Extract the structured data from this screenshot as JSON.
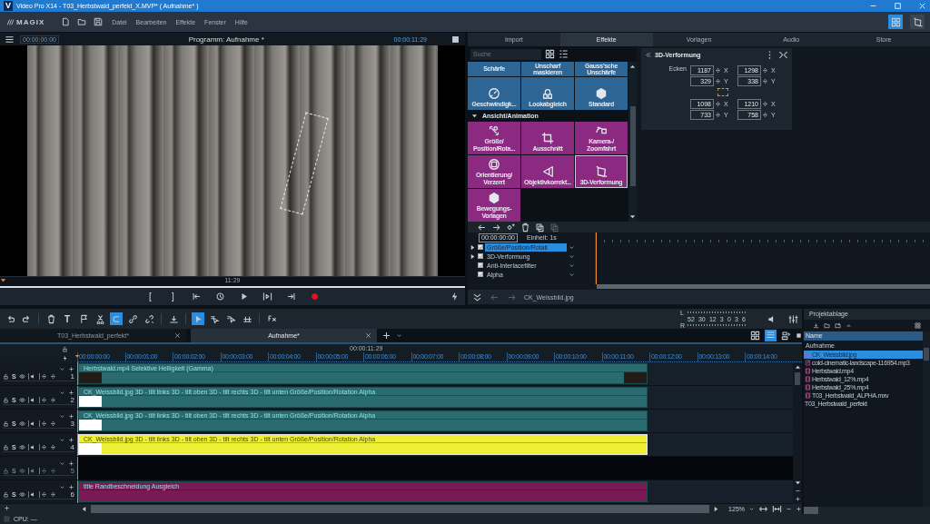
{
  "window": {
    "app_letter": "V",
    "title": "Video Pro X14 - T03_Herbstwald_perfekt_X.MVP* ( Aufnahme* )"
  },
  "menubar": {
    "logo": "MAGIX",
    "items": [
      "Datei",
      "Bearbeiten",
      "Effekte",
      "Fenster",
      "Hilfe"
    ]
  },
  "player": {
    "timecode": "00:00:00:00",
    "title": "Programm: Aufnahme *",
    "duration": "00:00:11:29",
    "scrub_label": "11:29",
    "mark_in": "[",
    "mark_out": "]"
  },
  "media_tabs": [
    {
      "label": "Import",
      "selected": false
    },
    {
      "label": "Effekte",
      "selected": true
    },
    {
      "label": "Vorlagen",
      "selected": false
    },
    {
      "label": "Audio",
      "selected": false
    },
    {
      "label": "Store",
      "selected": false
    }
  ],
  "effects": {
    "search": {
      "placeholder": "Suche"
    },
    "groups": [
      {
        "color": "#2d6594",
        "items": [
          {
            "label": "Schärfe",
            "kind": "text",
            "selected": false
          },
          {
            "label": "Unscharf maskieren",
            "kind": "text",
            "selected": false
          },
          {
            "label": "Gauss'sche Unschärfe",
            "kind": "text",
            "selected": false
          },
          {
            "label": "Geschwindigk...",
            "kind": "speed",
            "selected": false
          },
          {
            "label": "Lookabgleich",
            "kind": "look",
            "selected": false
          },
          {
            "label": "Standard",
            "kind": "hex",
            "selected": false
          }
        ]
      },
      {
        "title": "Ansicht/Animation",
        "expanded": true,
        "color": "#8b2a80",
        "items": [
          {
            "label": "Größe/ Position/Rota...",
            "kind": "resize",
            "selected": false
          },
          {
            "label": "Ausschnitt",
            "kind": "crop",
            "selected": false
          },
          {
            "label": "Kamera-/ Zoomfahrt",
            "kind": "camera",
            "selected": false
          },
          {
            "label": "Orientierung/ Verzerrt",
            "kind": "orient",
            "selected": false
          },
          {
            "label": "Objektivkorrekt...",
            "kind": "lens",
            "selected": false
          },
          {
            "label": "3D-Verformung",
            "kind": "warp",
            "selected": true
          },
          {
            "label": "Bewegungs-Vorlagen",
            "kind": "hex",
            "selected": false
          }
        ]
      }
    ]
  },
  "deform_panel": {
    "title": "3D-Verformung",
    "corners_label": "Ecken",
    "fields": [
      {
        "value": "1187",
        "axis": "X"
      },
      {
        "value": "1298",
        "axis": "X"
      },
      {
        "value": "329",
        "axis": "Y"
      },
      {
        "value": "338",
        "axis": "Y"
      },
      {
        "value": "1098",
        "axis": "X"
      },
      {
        "value": "1210",
        "axis": "X"
      },
      {
        "value": "733",
        "axis": "Y"
      },
      {
        "value": "758",
        "axis": "Y"
      }
    ]
  },
  "keyframes": {
    "timecode": "00:00:00:00",
    "unit": "Einheit: 1s",
    "rows": [
      {
        "label": "Größe/Position/Rotati",
        "checked": true,
        "selected": true,
        "has_children": true
      },
      {
        "label": "3D-Verformung",
        "checked": true,
        "selected": false,
        "has_children": true
      },
      {
        "label": "Anti-Interlacefilter",
        "checked": true,
        "selected": false,
        "has_children": false
      },
      {
        "label": "Alpha",
        "checked": true,
        "selected": false,
        "has_children": false
      }
    ]
  },
  "path_bar": {
    "file": "CK_Weissbild.jpg"
  },
  "toolbar": [
    {
      "kind": "undo",
      "on": false
    },
    {
      "kind": "redo",
      "on": false
    },
    {
      "kind": "sep"
    },
    {
      "kind": "delete",
      "on": false
    },
    {
      "kind": "text",
      "label": "T",
      "on": false
    },
    {
      "kind": "marker",
      "on": false
    },
    {
      "kind": "cut",
      "on": false
    },
    {
      "kind": "snap",
      "on": true
    },
    {
      "kind": "link",
      "on": false
    },
    {
      "kind": "unlink",
      "on": false
    },
    {
      "kind": "sep"
    },
    {
      "kind": "insert",
      "on": false
    },
    {
      "kind": "sep"
    },
    {
      "kind": "pointer",
      "on": true
    },
    {
      "kind": "trim",
      "on": false
    },
    {
      "kind": "slip",
      "on": false
    },
    {
      "kind": "range",
      "on": false
    },
    {
      "kind": "sep"
    },
    {
      "kind": "fx",
      "on": false
    }
  ],
  "meter": {
    "channels": [
      "L",
      "R"
    ],
    "scale": [
      "52",
      "30",
      "12",
      "3",
      "0",
      "3",
      "6"
    ]
  },
  "project_tabs": [
    {
      "label": "T03_Herbstwald_perfekt*",
      "selected": false
    },
    {
      "label": "Aufnahme*",
      "selected": true
    }
  ],
  "ruler": {
    "timecode": "00:00:11:29",
    "ticks": [
      "00:00:00:00",
      "00:00:01:00",
      "00:00:02:00",
      "00:00:03:00",
      "00:00:04:00",
      "00:00:05:00",
      "00:00:06:00",
      "00:00:07:00",
      "00:00:08:00",
      "00:00:09:00",
      "00:00:10:00",
      "00:00:11:00",
      "00:00:12:00",
      "00:00:13:00",
      "00:00:14:00"
    ]
  },
  "tracks": [
    {
      "number": "1",
      "solo": "S",
      "kind": "video",
      "clip": "Herbstwald.mp4  Selektive Helligkeit (Gamma)",
      "color": "#2a6b70",
      "selected": false
    },
    {
      "number": "2",
      "solo": "S",
      "kind": "image",
      "clip": "CK_Weissbild.jpg  3D - tilt links  3D - tilt oben  3D - tilt rechts  3D - tilt unten  Größe/Position/Rotation Alpha",
      "color": "#2a6b70",
      "selected": false
    },
    {
      "number": "3",
      "solo": "S",
      "kind": "image",
      "clip": "CK_Weissbild.jpg  3D - tilt links  3D - tilt oben  3D - tilt rechts  3D - tilt unten  Größe/Position/Rotation Alpha",
      "color": "#2a6b70",
      "selected": false
    },
    {
      "number": "4",
      "solo": "S",
      "kind": "image",
      "clip": "CK_Weissbild.jpg  3D - tilt links  3D - tilt oben  3D - tilt rechts  3D - tilt unten  Größe/Position/Rotation Alpha",
      "color": "#eef035",
      "selected": true
    },
    {
      "number": "5",
      "solo": "S",
      "kind": "empty"
    },
    {
      "number": "6",
      "solo": "S",
      "kind": "title",
      "clip": "title  Randbeschneidung Ausgleich",
      "color": "#7a1a55",
      "selected": false
    }
  ],
  "zoom": "125%",
  "bin": {
    "title": "Projektablage",
    "column": "Name",
    "folder": "Aufnahme",
    "files": [
      {
        "name": "CK_Weissbild.jpg",
        "kind": "image",
        "selected": true
      },
      {
        "name": "cold-cinematic-landscape-116954.mp3",
        "kind": "audio",
        "selected": false
      },
      {
        "name": "Herbstwald.mp4",
        "kind": "video",
        "selected": false
      },
      {
        "name": "Herbstwald_12%.mp4",
        "kind": "video",
        "selected": false
      },
      {
        "name": "Herbstwald_25%.mp4",
        "kind": "video",
        "selected": false
      },
      {
        "name": "T03_Herbstwald_ALPHA.mxv",
        "kind": "video",
        "selected": false
      },
      {
        "name": "T03_Herbstwald_perfekt",
        "kind": "project",
        "selected": false
      }
    ]
  },
  "status_bar": {
    "text": "CPU: —"
  }
}
